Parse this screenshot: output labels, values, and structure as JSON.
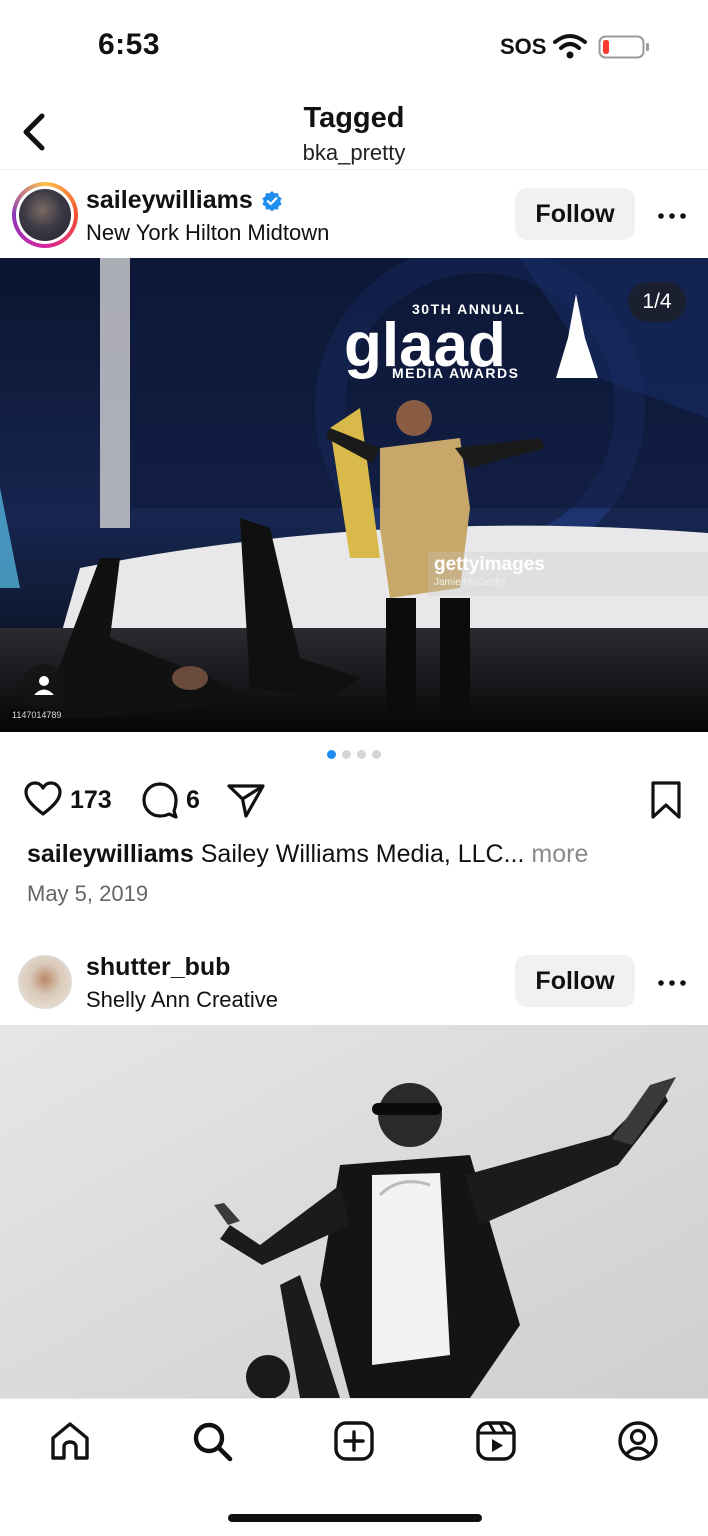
{
  "status_bar": {
    "time": "6:53",
    "carrier": "SOS"
  },
  "header": {
    "title": "Tagged",
    "subtitle": "bka_pretty"
  },
  "posts": [
    {
      "username": "saileywilliams",
      "verified": true,
      "location": "New York Hilton Midtown",
      "follow_label": "Follow",
      "media_counter": "1/4",
      "photo_id": "1147014789",
      "watermark_logo": "gettyimages",
      "watermark_credit": "Jamie McCarthy",
      "stage_banner_top": "30TH ANNUAL",
      "stage_banner_brand": "glaad",
      "stage_banner_bottom": "MEDIA AWARDS",
      "carousel": {
        "total": 4,
        "active_index": 0
      },
      "likes": "173",
      "comments": "6",
      "caption_user": "saileywilliams",
      "caption_text": "Sailey Williams Media, LLC...",
      "caption_more": "more",
      "date": "May 5, 2019"
    },
    {
      "username": "shutter_bub",
      "verified": false,
      "location": "Shelly Ann Creative",
      "follow_label": "Follow"
    }
  ],
  "tab_bar": {
    "items": [
      "home-icon",
      "search-icon",
      "create-icon",
      "reels-icon",
      "profile-icon"
    ]
  },
  "colors": {
    "accent_blue": "#1d8ef0",
    "button_bg": "#eff1f3",
    "story_ring": [
      "#fdc14a",
      "#f5512f",
      "#d6249f",
      "#8a3ab9"
    ]
  }
}
